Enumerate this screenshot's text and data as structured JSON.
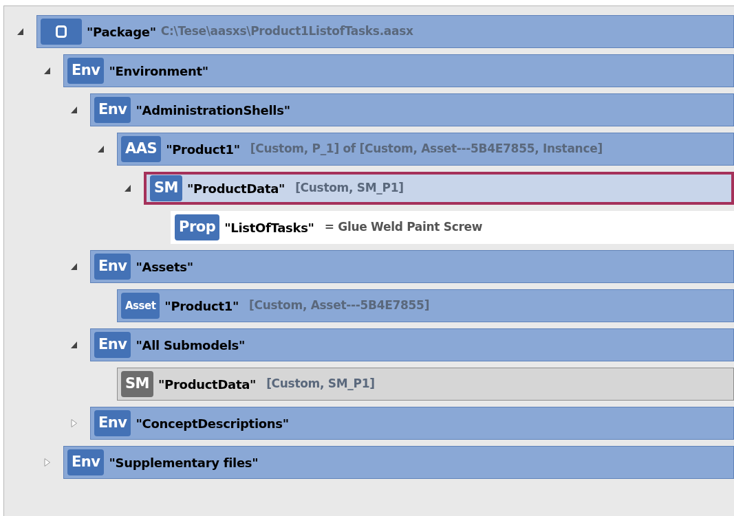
{
  "tree": [
    {
      "kind": "package",
      "selected": false,
      "expanded": true,
      "name": "\"Package\"",
      "info": "C:\\Tese\\aasxs\\Product1ListofTasks.aasx",
      "children": [
        {
          "kind": "element",
          "selected": false,
          "expanded": true,
          "badge": "Env",
          "name": "\"Environment\"",
          "children": [
            {
              "kind": "element",
              "selected": false,
              "expanded": true,
              "badge": "Env",
              "name": "\"AdministrationShells\"",
              "children": [
                {
                  "kind": "element",
                  "selected": false,
                  "expanded": true,
                  "badge": "AAS",
                  "name": "\"Product1\"",
                  "info": "[Custom, P_1] of [Custom, Asset---5B4E7855, Instance]",
                  "children": [
                    {
                      "kind": "element",
                      "selected": true,
                      "expanded": true,
                      "badge": "SM",
                      "name": "\"ProductData\"",
                      "info": "[Custom, SM_P1]",
                      "children": [
                        {
                          "kind": "property",
                          "selected": false,
                          "badge": "Prop",
                          "name": "\"ListOfTasks\"",
                          "info": "= Glue Weld Paint Screw"
                        }
                      ]
                    }
                  ]
                }
              ]
            },
            {
              "kind": "element",
              "selected": false,
              "expanded": true,
              "badge": "Env",
              "name": "\"Assets\"",
              "children": [
                {
                  "kind": "element",
                  "selected": false,
                  "badge": "Asset",
                  "name": "\"Product1\"",
                  "info": "[Custom, Asset---5B4E7855]"
                }
              ]
            },
            {
              "kind": "element",
              "selected": false,
              "expanded": true,
              "badge": "Env",
              "name": "\"All Submodels\"",
              "children": [
                {
                  "kind": "reference",
                  "selected": false,
                  "badge": "SM",
                  "name": "\"ProductData\"",
                  "info": "[Custom, SM_P1]"
                }
              ]
            },
            {
              "kind": "element",
              "selected": false,
              "expanded": false,
              "badge": "Env",
              "name": "\"ConceptDescriptions\""
            }
          ]
        },
        {
          "kind": "element",
          "selected": false,
          "expanded": false,
          "badge": "Env",
          "name": "\"Supplementary files\""
        }
      ]
    }
  ]
}
